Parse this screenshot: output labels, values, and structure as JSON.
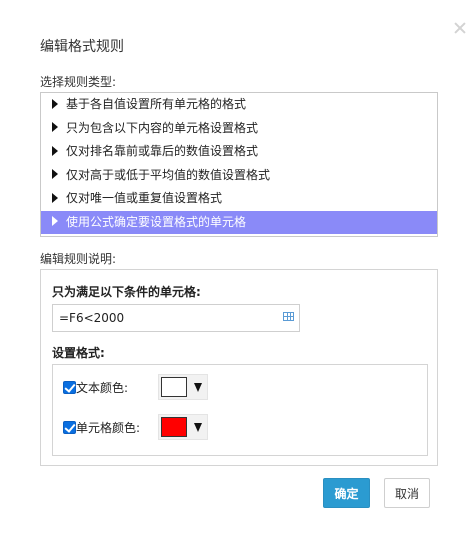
{
  "dialog": {
    "title": "编辑格式规则",
    "close_icon": "close-icon"
  },
  "rule_type": {
    "label": "选择规则类型:",
    "items": [
      {
        "label": "基于各自值设置所有单元格的格式",
        "selected": false
      },
      {
        "label": "只为包含以下内容的单元格设置格式",
        "selected": false
      },
      {
        "label": "仅对排名靠前或靠后的数值设置格式",
        "selected": false
      },
      {
        "label": "仅对高于或低于平均值的数值设置格式",
        "selected": false
      },
      {
        "label": "仅对唯一值或重复值设置格式",
        "selected": false
      },
      {
        "label": "使用公式确定要设置格式的单元格",
        "selected": true
      }
    ]
  },
  "rule_description": {
    "label": "编辑规则说明:",
    "condition_label": "只为满足以下条件的单元格:",
    "formula_value": "=F6<2000",
    "format_label": "设置格式:",
    "text_color": {
      "label": "文本颜色:",
      "checked": true,
      "color": "#ffffff"
    },
    "cell_color": {
      "label": "单元格颜色:",
      "checked": true,
      "color": "#ff0000"
    }
  },
  "buttons": {
    "ok": "确定",
    "cancel": "取消"
  },
  "colors": {
    "selected_row": "#8a8af8",
    "ok_button": "#2b9bd1"
  }
}
